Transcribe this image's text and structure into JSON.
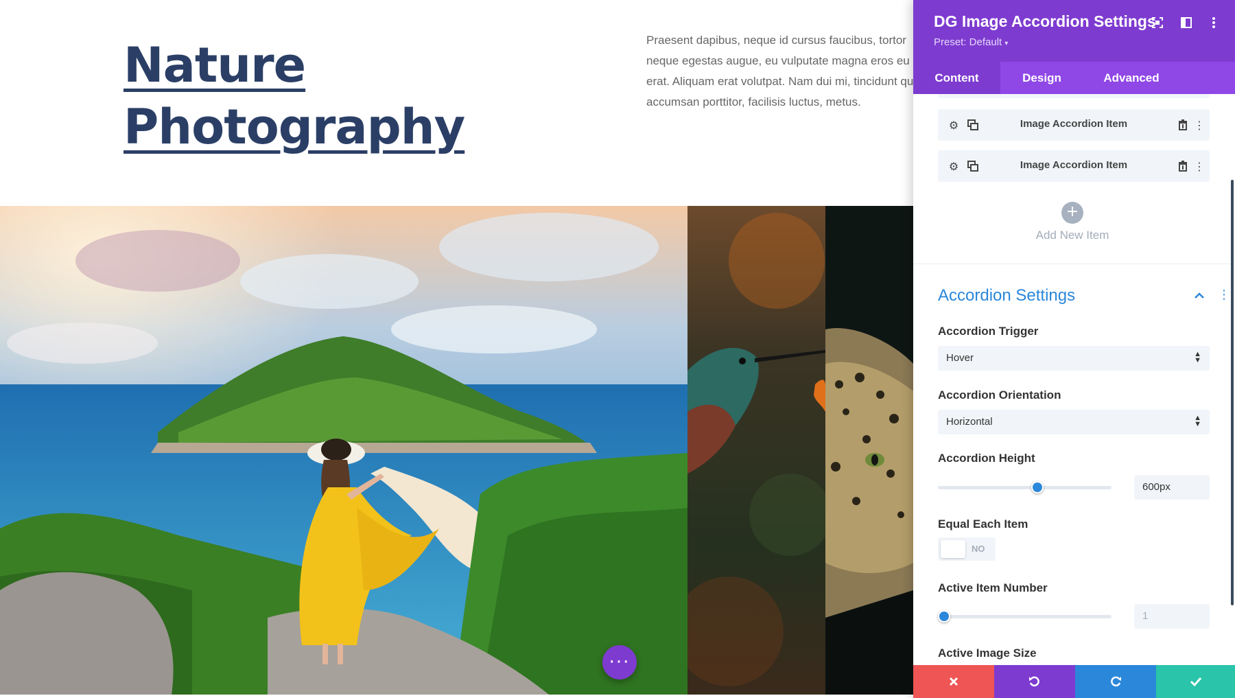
{
  "hero": {
    "title_line1": "Nature",
    "title_line2": "Photography",
    "text": "Praesent dapibus, neque id cursus faucibus, tortor neque egestas augue, eu vulputate magna eros eu erat. Aliquam erat volutpat. Nam dui mi, tincidunt quis, accumsan porttitor, facilisis luctus, metus."
  },
  "accordion": {
    "items": [
      {
        "name": "island-lady-photo"
      },
      {
        "name": "hummingbird-photo"
      },
      {
        "name": "leopard-photo"
      }
    ]
  },
  "fab": {
    "icon": "more-dots-icon",
    "label": "···"
  },
  "panel": {
    "title": "DG Image Accordion Settings",
    "preset": "Preset: Default",
    "preset_caret": "▾",
    "tabs": [
      "Content",
      "Design",
      "Advanced"
    ],
    "active_tab": "Content",
    "items": [
      {
        "label": "Image Accordion Item"
      },
      {
        "label": "Image Accordion Item"
      }
    ],
    "add_new_label": "Add New Item",
    "section_title": "Accordion Settings",
    "fields": {
      "trigger_label": "Accordion Trigger",
      "trigger_value": "Hover",
      "orientation_label": "Accordion Orientation",
      "orientation_value": "Horizontal",
      "height_label": "Accordion Height",
      "height_value": "600px",
      "height_slider_fraction": 0.58,
      "equal_label": "Equal Each Item",
      "equal_value": "NO",
      "active_item_label": "Active Item Number",
      "active_item_value": "1",
      "active_item_slider_fraction": 0.0,
      "active_image_size_label": "Active Image Size"
    },
    "footer": {
      "cancel_color": "#ef5555",
      "undo_color": "#7e3bd0",
      "redo_color": "#2b87da",
      "save_color": "#29c4a9"
    }
  },
  "colors": {
    "accent_purple": "#7e3bd0",
    "tab_purple": "#8f47e6",
    "link_blue": "#2b87da",
    "title_navy": "#2b3f66"
  }
}
